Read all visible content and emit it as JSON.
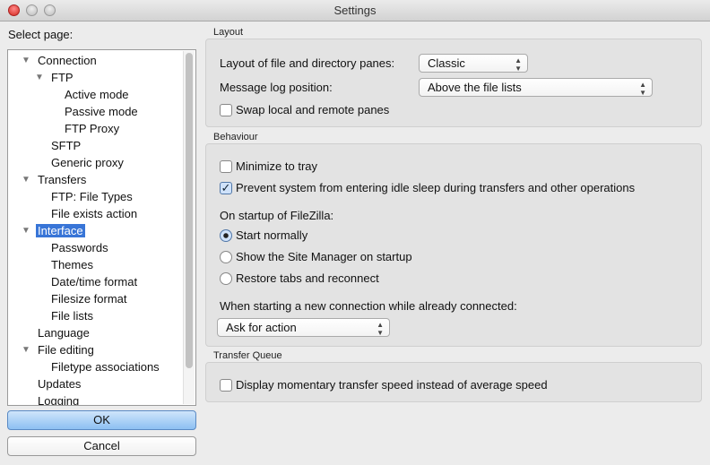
{
  "window": {
    "title": "Settings"
  },
  "sidebar": {
    "label": "Select page:",
    "items": [
      {
        "label": "Connection",
        "level": 0,
        "expander": true
      },
      {
        "label": "FTP",
        "level": 1,
        "expander": true
      },
      {
        "label": "Active mode",
        "level": 2
      },
      {
        "label": "Passive mode",
        "level": 2
      },
      {
        "label": "FTP Proxy",
        "level": 2
      },
      {
        "label": "SFTP",
        "level": 1
      },
      {
        "label": "Generic proxy",
        "level": 1
      },
      {
        "label": "Transfers",
        "level": 0,
        "expander": true
      },
      {
        "label": "FTP: File Types",
        "level": 1
      },
      {
        "label": "File exists action",
        "level": 1
      },
      {
        "label": "Interface",
        "level": 0,
        "expander": true,
        "selected": true
      },
      {
        "label": "Passwords",
        "level": 1
      },
      {
        "label": "Themes",
        "level": 1
      },
      {
        "label": "Date/time format",
        "level": 1
      },
      {
        "label": "Filesize format",
        "level": 1
      },
      {
        "label": "File lists",
        "level": 1
      },
      {
        "label": "Language",
        "level": 0
      },
      {
        "label": "File editing",
        "level": 0,
        "expander": true
      },
      {
        "label": "Filetype associations",
        "level": 1
      },
      {
        "label": "Updates",
        "level": 0
      },
      {
        "label": "Logging",
        "level": 0
      }
    ]
  },
  "buttons": {
    "ok": "OK",
    "cancel": "Cancel"
  },
  "layout": {
    "title": "Layout",
    "panes_label": "Layout of file and directory panes:",
    "panes_value": "Classic",
    "log_label": "Message log position:",
    "log_value": "Above the file lists",
    "swap_label": "Swap local and remote panes",
    "swap_checked": false
  },
  "behaviour": {
    "title": "Behaviour",
    "minimize_label": "Minimize to tray",
    "minimize_checked": false,
    "prevent_label": "Prevent system from entering idle sleep during transfers and other operations",
    "prevent_checked": true,
    "startup_label": "On startup of FileZilla:",
    "startup_options": [
      "Start normally",
      "Show the Site Manager on startup",
      "Restore tabs and reconnect"
    ],
    "startup_selected": 0,
    "newconn_label": "When starting a new connection while already connected:",
    "newconn_value": "Ask for action"
  },
  "queue": {
    "title": "Transfer Queue",
    "speed_label": "Display momentary transfer speed instead of average speed",
    "speed_checked": false
  },
  "colors": {
    "selection": "#3875d7",
    "ok_button": "#8dc0f2"
  }
}
